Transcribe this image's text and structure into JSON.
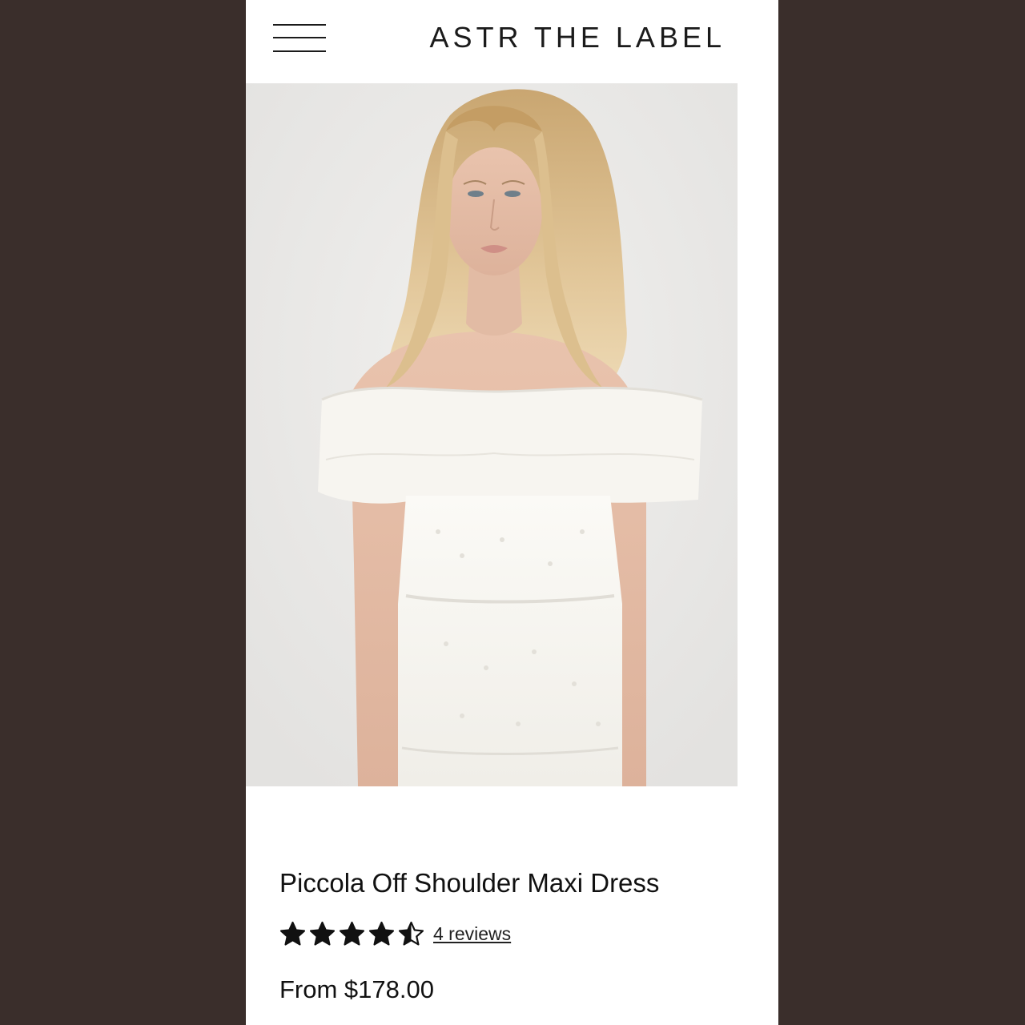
{
  "header": {
    "brand": "ASTR THE LABEL",
    "menu_icon": "hamburger-menu-icon"
  },
  "product": {
    "title": "Piccola Off Shoulder Maxi Dress",
    "rating": 4.5,
    "rating_max": 5,
    "reviews_label": "4 reviews",
    "price_label": "From $178.00",
    "image_alt": "Model wearing white off-shoulder eyelet maxi dress"
  },
  "colors": {
    "backdrop": "#3a2e2b",
    "page": "#ffffff",
    "text": "#111111",
    "star": "#111111"
  }
}
